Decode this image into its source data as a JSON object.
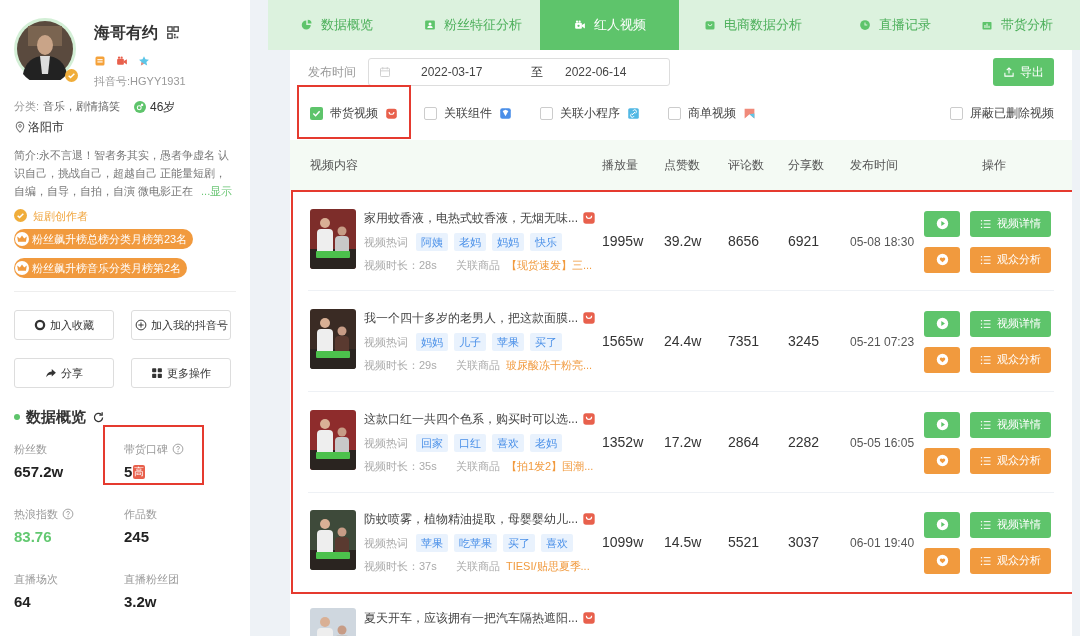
{
  "profile": {
    "name": "海哥有约",
    "douyin_id": "抖音号:HGYY1931",
    "category_label": "分类:",
    "categories": "音乐，剧情搞笑",
    "age": "46岁",
    "city": "洛阳市",
    "bio": "简介:永不言退！智者务其实，愚者争虚名 认识自己，挑战自己，超越自己 正能量短剧，自编，自导，自拍，自演 微电影正在",
    "more": "...显示",
    "creator_tag": "短剧创作者",
    "ranks": [
      "粉丝飙升榜总榜分类月榜第23名",
      "粉丝飙升榜音乐分类月榜第2名"
    ]
  },
  "actions": [
    {
      "kind": "circle",
      "label": "加入收藏"
    },
    {
      "kind": "plus",
      "label": "加入我的抖音号"
    },
    {
      "kind": "share",
      "label": "分享"
    },
    {
      "kind": "grid",
      "label": "更多操作"
    }
  ],
  "overview": {
    "title": "数据概览",
    "stats": [
      {
        "label": "粉丝数",
        "help": false,
        "value": "657.2w",
        "accent": false,
        "highlighted": false
      },
      {
        "label": "带货口碑",
        "help": true,
        "value": "5",
        "badge": "高",
        "accent": false,
        "highlighted": true
      },
      {
        "label": "热浪指数",
        "help": true,
        "value": "83.76",
        "accent": true,
        "highlighted": false
      },
      {
        "label": "作品数",
        "help": false,
        "value": "245",
        "accent": false,
        "highlighted": false
      },
      {
        "label": "直播场次",
        "help": false,
        "value": "64",
        "accent": false,
        "highlighted": false
      },
      {
        "label": "直播粉丝团",
        "help": false,
        "value": "3.2w",
        "accent": false,
        "highlighted": false
      }
    ]
  },
  "tabs": [
    {
      "kind": "pie",
      "label": "数据概览",
      "selected": false
    },
    {
      "kind": "person",
      "label": "粉丝特征分析",
      "selected": false
    },
    {
      "kind": "camera",
      "label": "红人视频",
      "selected": true
    },
    {
      "kind": "bag",
      "label": "电商数据分析",
      "selected": false
    },
    {
      "kind": "clock",
      "label": "直播记录",
      "selected": false
    },
    {
      "kind": "chart",
      "label": "带货分析",
      "selected": false
    }
  ],
  "date_filter": {
    "label": "发布时间",
    "start": "2022-03-17",
    "separator": "至",
    "end": "2022-06-14"
  },
  "export_button": "导出",
  "filters": [
    {
      "label": "带货视频",
      "checked": true,
      "kind": "bag",
      "highlighted": true
    },
    {
      "label": "关联组件",
      "checked": false,
      "kind": "shield",
      "highlighted": false
    },
    {
      "label": "关联小程序",
      "checked": false,
      "kind": "link",
      "highlighted": false
    },
    {
      "label": "商单视频",
      "checked": false,
      "kind": "flag",
      "highlighted": false
    },
    {
      "label": "屏蔽已删除视频",
      "checked": false,
      "highlighted": false
    }
  ],
  "table": {
    "columns": [
      "视频内容",
      "播放量",
      "点赞数",
      "评论数",
      "分享数",
      "发布时间",
      "操作"
    ],
    "rows": [
      {
        "title": "家用蚊香液，电热式蚊香液，无烟无味...",
        "keyword_label": "视频热词",
        "keywords": [
          "阿姨",
          "老妈",
          "妈妈",
          "快乐"
        ],
        "duration": "视频时长：28s",
        "product_label": "关联商品",
        "product": "【现货速发】三...",
        "plays": "1995w",
        "likes": "39.2w",
        "comments": "8656",
        "shares": "6921",
        "time": "05-08 18:30",
        "detail_button": "视频详情",
        "audience_button": "观众分析",
        "highlighted": true
      },
      {
        "title": "我一个四十多岁的老男人，把这款面膜...",
        "keyword_label": "视频热词",
        "keywords": [
          "妈妈",
          "儿子",
          "苹果",
          "买了"
        ],
        "duration": "视频时长：29s",
        "product_label": "关联商品",
        "product": "玻尿酸冻干粉亮...",
        "plays": "1565w",
        "likes": "24.4w",
        "comments": "7351",
        "shares": "3245",
        "time": "05-21 07:23",
        "detail_button": "视频详情",
        "audience_button": "观众分析",
        "highlighted": true
      },
      {
        "title": "这款口红一共四个色系，购买时可以选...",
        "keyword_label": "视频热词",
        "keywords": [
          "回家",
          "口红",
          "喜欢",
          "老妈"
        ],
        "duration": "视频时长：35s",
        "product_label": "关联商品",
        "product": "【拍1发2】国潮...",
        "plays": "1352w",
        "likes": "17.2w",
        "comments": "2864",
        "shares": "2282",
        "time": "05-05 16:05",
        "detail_button": "视频详情",
        "audience_button": "观众分析",
        "highlighted": true
      },
      {
        "title": "防蚊喷雾，植物精油提取，母婴婴幼儿...",
        "keyword_label": "视频热词",
        "keywords": [
          "苹果",
          "吃苹果",
          "买了",
          "喜欢"
        ],
        "duration": "视频时长：37s",
        "product_label": "关联商品",
        "product": "TIESI/贴思夏季...",
        "plays": "1099w",
        "likes": "14.5w",
        "comments": "5521",
        "shares": "3037",
        "time": "06-01 19:40",
        "detail_button": "视频详情",
        "audience_button": "观众分析",
        "highlighted": true
      },
      {
        "title": "夏天开车，应该拥有一把汽车隔热遮阳...",
        "highlighted": false
      }
    ]
  }
}
